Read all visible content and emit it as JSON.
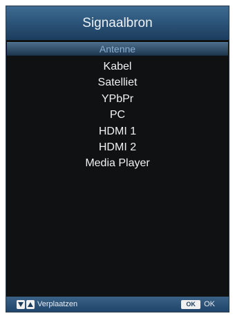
{
  "dialog": {
    "title": "Signaalbron"
  },
  "menu": {
    "items": [
      {
        "label": "Antenne",
        "selected": true
      },
      {
        "label": "Kabel"
      },
      {
        "label": "Satelliet"
      },
      {
        "label": "YPbPr"
      },
      {
        "label": "PC"
      },
      {
        "label": "HDMI 1"
      },
      {
        "label": "HDMI 2"
      },
      {
        "label": "Media Player"
      }
    ]
  },
  "footer": {
    "move_icons": [
      "down-arrow-icon",
      "up-arrow-icon"
    ],
    "move_label": "Verplaatzen",
    "ok_key": "OK",
    "ok_label": "OK"
  }
}
